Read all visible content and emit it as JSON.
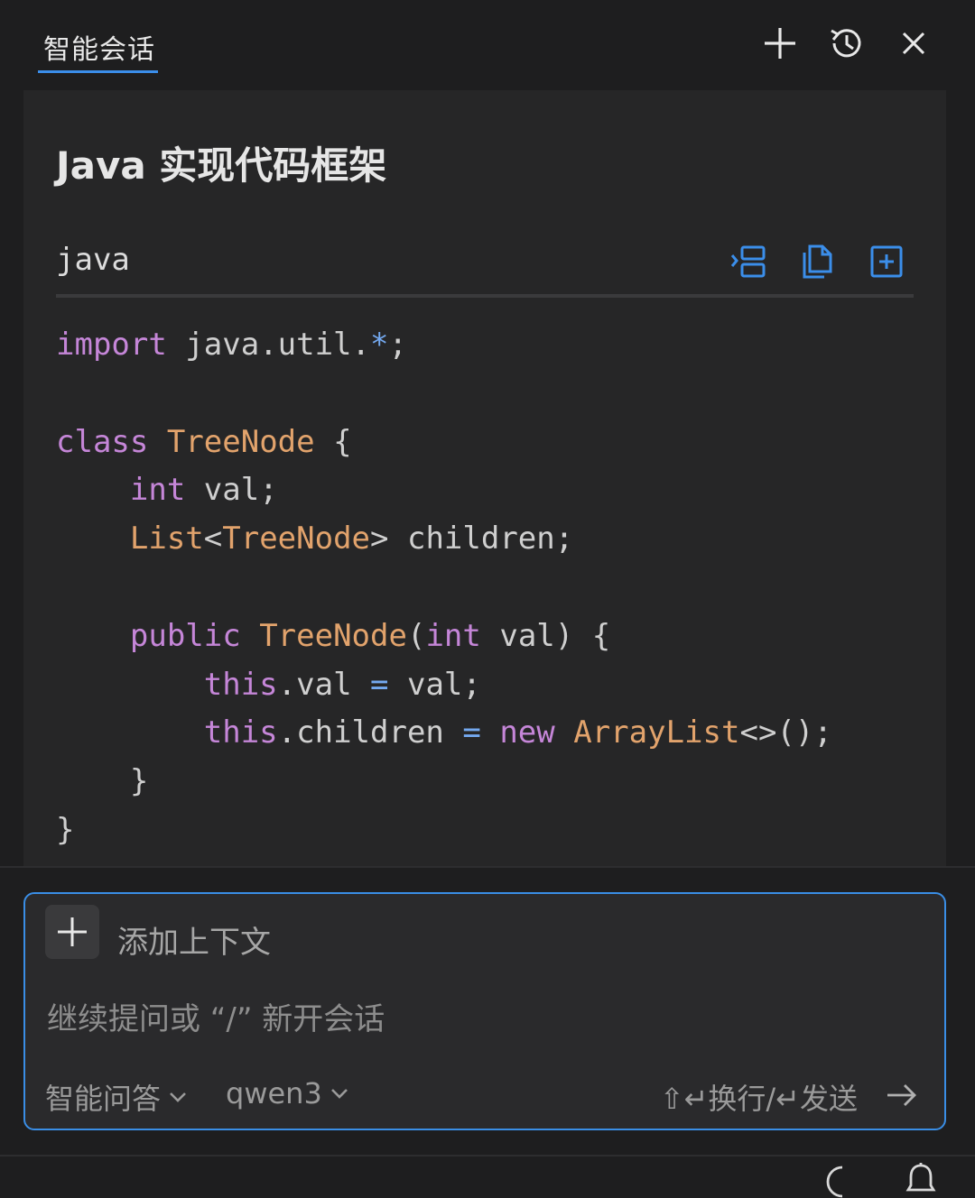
{
  "header": {
    "tab_label": "智能会话",
    "icons": [
      "add-icon",
      "history-icon",
      "close-icon"
    ]
  },
  "response": {
    "title": "Java 实现代码框架",
    "code_block": {
      "language": "java",
      "actions": [
        "insert-icon",
        "copy-icon",
        "new-file-icon"
      ],
      "lines": [
        [
          {
            "t": "import",
            "c": "kw"
          },
          {
            "t": " java.util.",
            "c": "pl"
          },
          {
            "t": "*",
            "c": "op"
          },
          {
            "t": ";",
            "c": "pl"
          }
        ],
        [],
        [
          {
            "t": "class",
            "c": "kw"
          },
          {
            "t": " ",
            "c": "pl"
          },
          {
            "t": "TreeNode",
            "c": "ty"
          },
          {
            "t": " {",
            "c": "pl"
          }
        ],
        [
          {
            "t": "    ",
            "c": "pl"
          },
          {
            "t": "int",
            "c": "kw"
          },
          {
            "t": " val;",
            "c": "pl"
          }
        ],
        [
          {
            "t": "    ",
            "c": "pl"
          },
          {
            "t": "List",
            "c": "ty"
          },
          {
            "t": "<",
            "c": "pl"
          },
          {
            "t": "TreeNode",
            "c": "ty"
          },
          {
            "t": "> children;",
            "c": "pl"
          }
        ],
        [],
        [
          {
            "t": "    ",
            "c": "pl"
          },
          {
            "t": "public",
            "c": "kw"
          },
          {
            "t": " ",
            "c": "pl"
          },
          {
            "t": "TreeNode",
            "c": "ty"
          },
          {
            "t": "(",
            "c": "pl"
          },
          {
            "t": "int",
            "c": "kw"
          },
          {
            "t": " val) {",
            "c": "pl"
          }
        ],
        [
          {
            "t": "        ",
            "c": "pl"
          },
          {
            "t": "this",
            "c": "kw"
          },
          {
            "t": ".val ",
            "c": "pl"
          },
          {
            "t": "=",
            "c": "op"
          },
          {
            "t": " val;",
            "c": "pl"
          }
        ],
        [
          {
            "t": "        ",
            "c": "pl"
          },
          {
            "t": "this",
            "c": "kw"
          },
          {
            "t": ".children ",
            "c": "pl"
          },
          {
            "t": "=",
            "c": "op"
          },
          {
            "t": " ",
            "c": "pl"
          },
          {
            "t": "new",
            "c": "kw"
          },
          {
            "t": " ",
            "c": "pl"
          },
          {
            "t": "ArrayList",
            "c": "ty"
          },
          {
            "t": "<>();",
            "c": "pl"
          }
        ],
        [
          {
            "t": "    }",
            "c": "pl"
          }
        ],
        [
          {
            "t": "}",
            "c": "pl"
          }
        ]
      ]
    }
  },
  "composer": {
    "add_context_label": "添加上下文",
    "placeholder": "继续提问或 “/” 新开会话",
    "mode_label": "智能问答",
    "model_label": "qwen3",
    "hint_label": "⇧↵换行/↵发送"
  },
  "colors": {
    "accent": "#3a8ee6",
    "keyword": "#c586d8",
    "type": "#e2a36c",
    "operator": "#74a9f0"
  }
}
